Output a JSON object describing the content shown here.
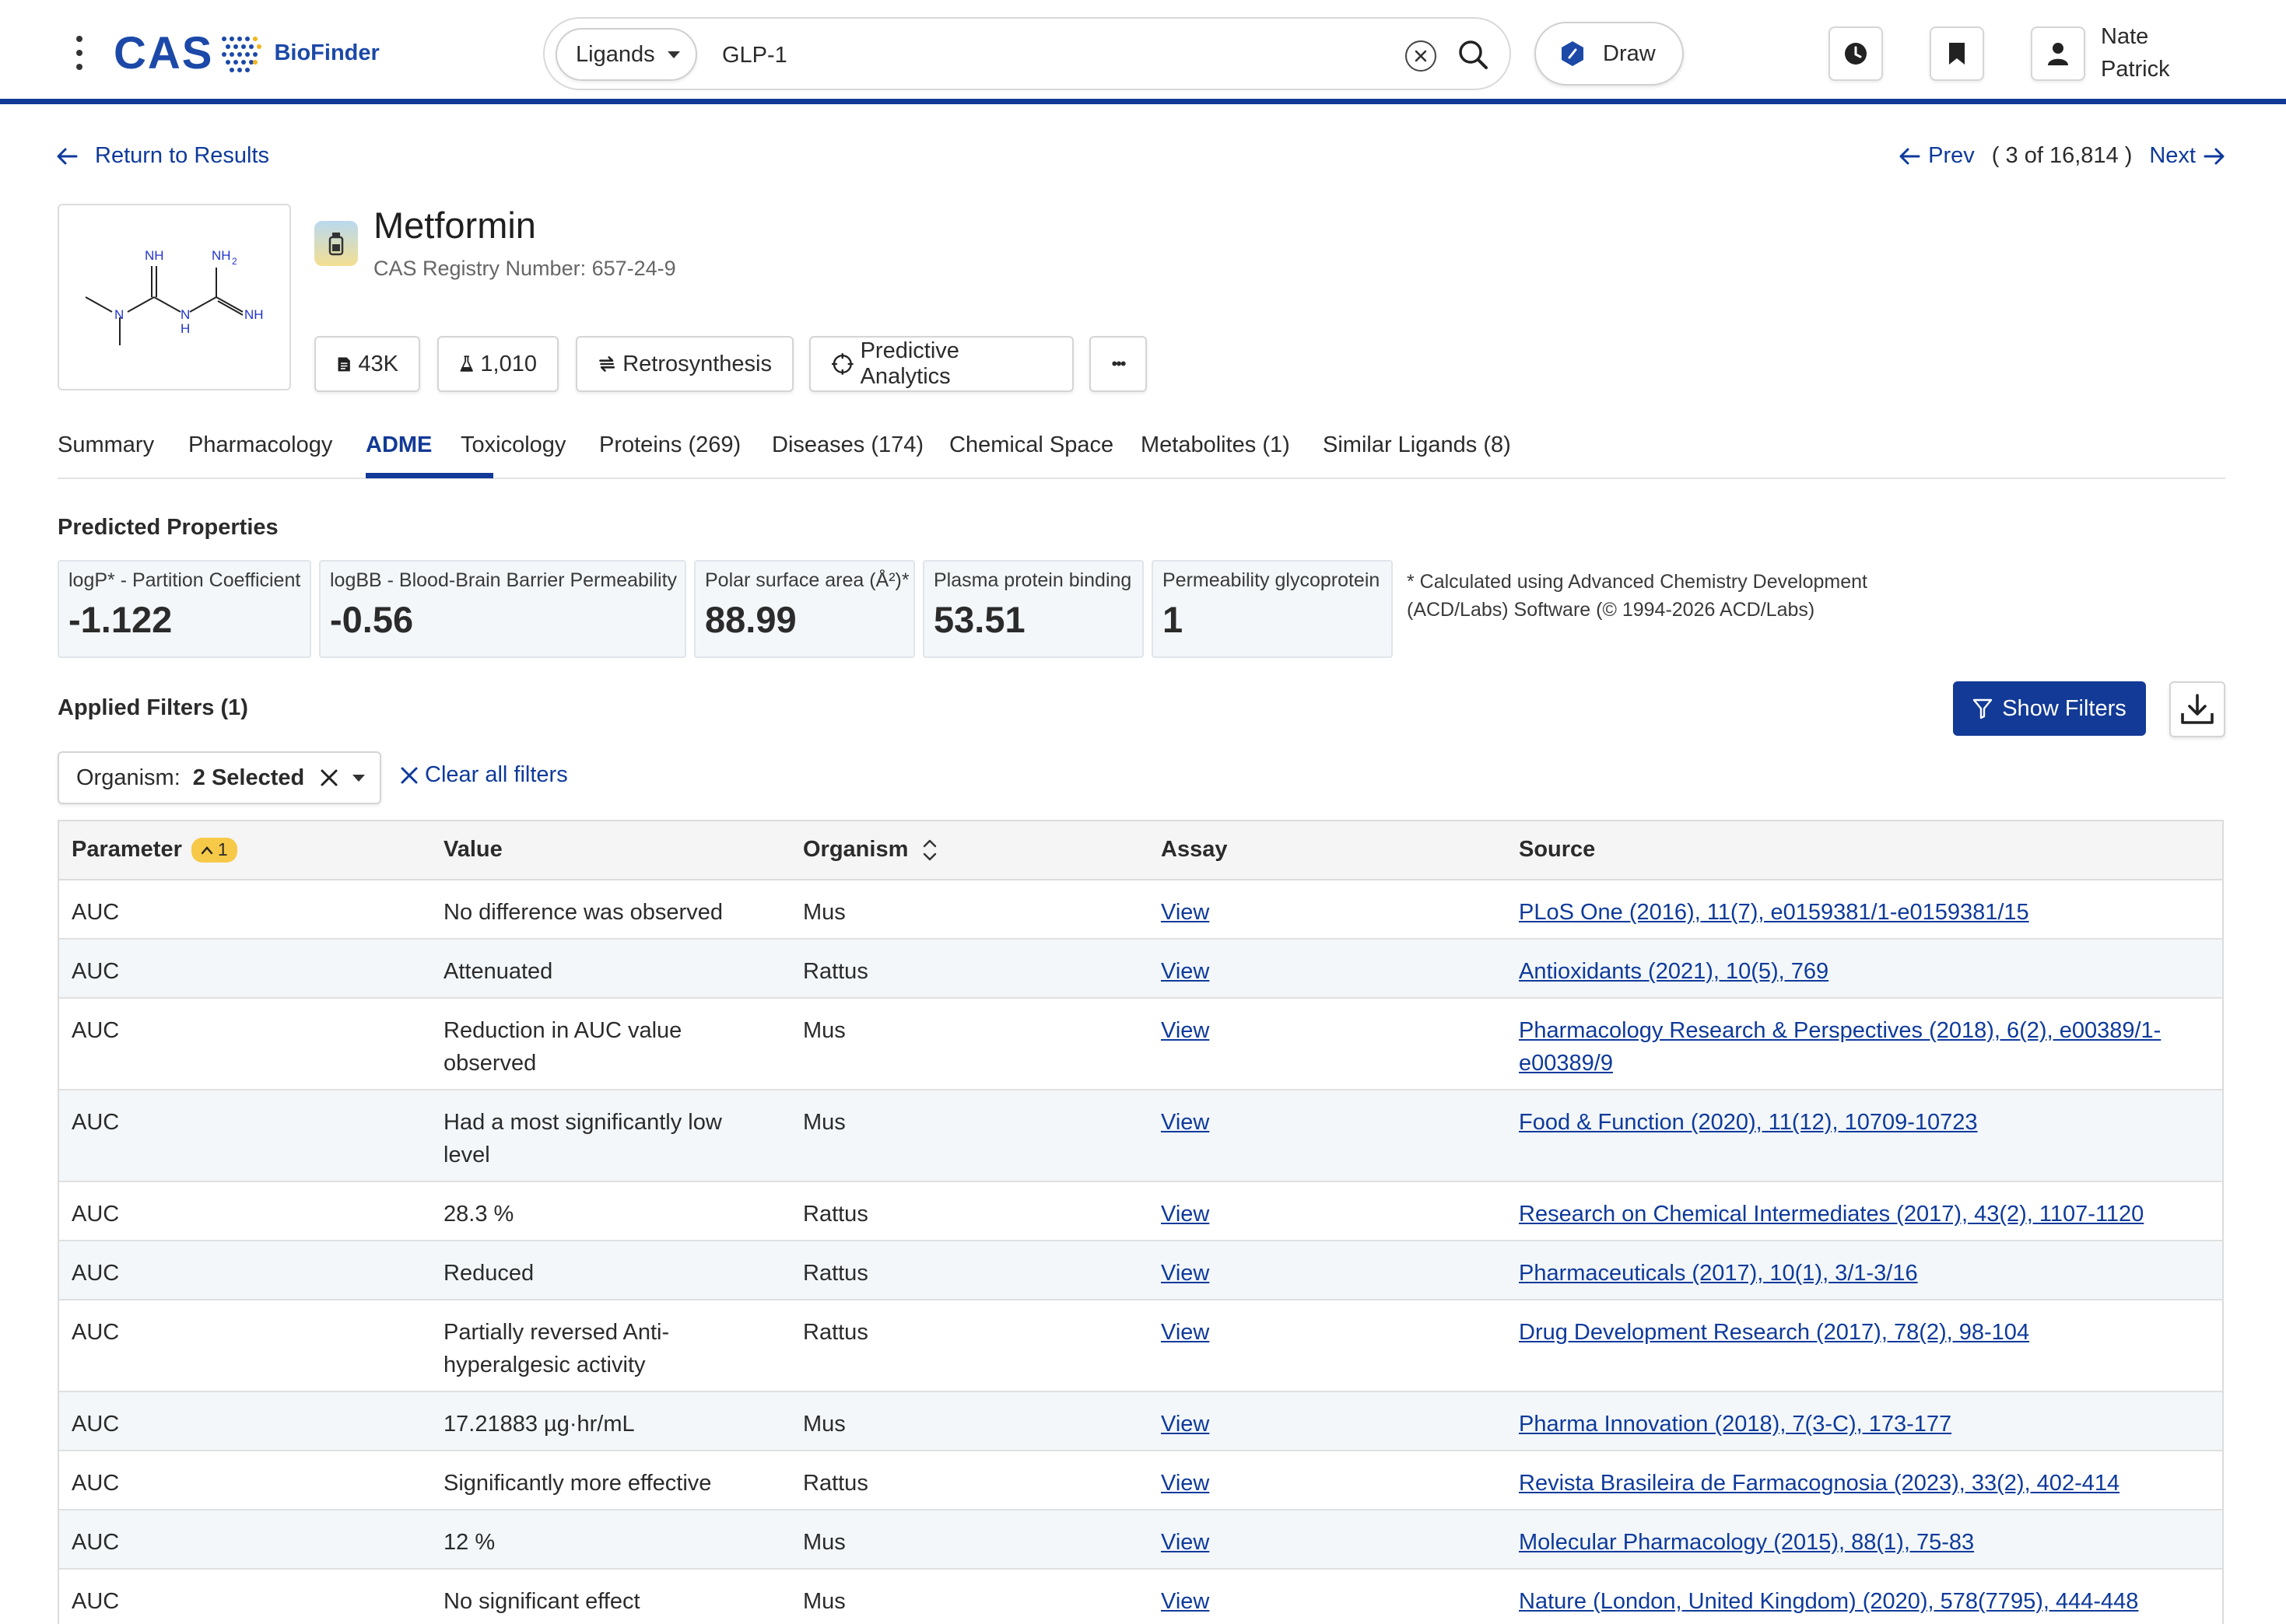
{
  "brand": {
    "logo_text": "CAS",
    "product": "BioFinder"
  },
  "search": {
    "category": "Ligands",
    "query": "GLP-1",
    "draw_label": "Draw"
  },
  "user": {
    "first": "Nate",
    "last": "Patrick"
  },
  "nav": {
    "return_label": "Return to Results",
    "prev_label": "Prev",
    "next_label": "Next",
    "position": "( 3 of 16,814 )"
  },
  "compound": {
    "name": "Metformin",
    "registry": "CAS Registry Number: 657-24-9",
    "structure_labels": {
      "nh_top": "NH",
      "nh2": "NH",
      "nh2_sub": "2",
      "n_left": "N",
      "n_mid": "N",
      "h_mid": "H",
      "nh_right": "NH"
    }
  },
  "chips": {
    "references": "43K",
    "substances": "1,010",
    "retro": "Retrosynthesis",
    "predictive": "Predictive Analytics",
    "more": "•••"
  },
  "tabs": [
    "Summary",
    "Pharmacology",
    "ADME",
    "Toxicology",
    "Proteins (269)",
    "Diseases (174)",
    "Chemical Space",
    "Metabolites (1)",
    "Similar Ligands (8)"
  ],
  "active_tab": "ADME",
  "predicted": {
    "title": "Predicted Properties",
    "props": [
      {
        "label": "logP* - Partition Coefficient",
        "value": "-1.122"
      },
      {
        "label": "logBB - Blood-Brain Barrier Permeability",
        "value": "-0.56"
      },
      {
        "label": "Polar surface area (Å²)*",
        "value": "88.99"
      },
      {
        "label": "Plasma protein binding",
        "value": "53.51"
      },
      {
        "label": "Permeability glycoprotein",
        "value": "1"
      }
    ],
    "footnote": "* Calculated using Advanced Chemistry Development (ACD/Labs) Software (© 1994-2026 ACD/Labs)"
  },
  "filters": {
    "title": "Applied Filters (1)",
    "show_label": "Show Filters",
    "organism_label": "Organism:",
    "organism_value": "2 Selected",
    "clear_label": "Clear all filters"
  },
  "table": {
    "headers": {
      "parameter": "Parameter",
      "sort_badge": "1",
      "value": "Value",
      "organism": "Organism",
      "assay": "Assay",
      "source": "Source"
    },
    "rows": [
      {
        "parameter": "AUC",
        "value": "No difference was observed",
        "organism": "Mus",
        "assay": "View",
        "source": "PLoS One (2016), 11(7), e0159381/1-e0159381/15"
      },
      {
        "parameter": "AUC",
        "value": "Attenuated",
        "organism": "Rattus",
        "assay": "View",
        "source": "Antioxidants (2021), 10(5), 769"
      },
      {
        "parameter": "AUC",
        "value": "Reduction in AUC value observed",
        "organism": "Mus",
        "assay": "View",
        "source": "Pharmacology Research & Perspectives (2018), 6(2), e00389/1-e00389/9"
      },
      {
        "parameter": "AUC",
        "value": "Had a most significantly low level",
        "organism": "Mus",
        "assay": "View",
        "source": "Food & Function (2020), 11(12), 10709-10723"
      },
      {
        "parameter": "AUC",
        "value": "28.3 %",
        "organism": "Rattus",
        "assay": "View",
        "source": "Research on Chemical Intermediates (2017), 43(2), 1107-1120"
      },
      {
        "parameter": "AUC",
        "value": "Reduced",
        "organism": "Rattus",
        "assay": "View",
        "source": "Pharmaceuticals (2017), 10(1), 3/1-3/16"
      },
      {
        "parameter": "AUC",
        "value": "Partially reversed Anti-hyperalgesic activity",
        "organism": "Rattus",
        "assay": "View",
        "source": "Drug Development Research (2017), 78(2), 98-104"
      },
      {
        "parameter": "AUC",
        "value": "17.21883 µg·hr/mL",
        "organism": "Mus",
        "assay": "View",
        "source": "Pharma Innovation (2018), 7(3-C), 173-177"
      },
      {
        "parameter": "AUC",
        "value": "Significantly more effective",
        "organism": "Rattus",
        "assay": "View",
        "source": "Revista Brasileira de Farmacognosia (2023), 33(2), 402-414"
      },
      {
        "parameter": "AUC",
        "value": "12 %",
        "organism": "Mus",
        "assay": "View",
        "source": "Molecular Pharmacology (2015), 88(1), 75-83"
      },
      {
        "parameter": "AUC",
        "value": "No significant effect",
        "organism": "Mus",
        "assay": "View",
        "source": "Nature (London, United Kingdom) (2020), 578(7795), 444-448"
      }
    ]
  },
  "icons": {
    "menu": "kebab-menu-icon",
    "logo_mark": "cas-dots-icon",
    "clear": "close-circle-icon",
    "search": "search-icon",
    "draw": "hexagon-icon",
    "history": "clock-icon",
    "saved": "bookmark-icon",
    "user": "user-icon",
    "back": "arrow-left-icon",
    "forward": "arrow-right-icon",
    "ligand": "vial-icon",
    "references": "document-icon",
    "substances": "flask-icon",
    "retro": "retrosynthesis-icon",
    "predictive": "target-icon",
    "filter": "funnel-icon",
    "download": "download-icon",
    "sort": "sort-icon"
  },
  "colors": {
    "brand": "#123a96",
    "link": "#0e3a9b",
    "badge": "#f7c948",
    "row_alt": "#f3f7fa"
  }
}
